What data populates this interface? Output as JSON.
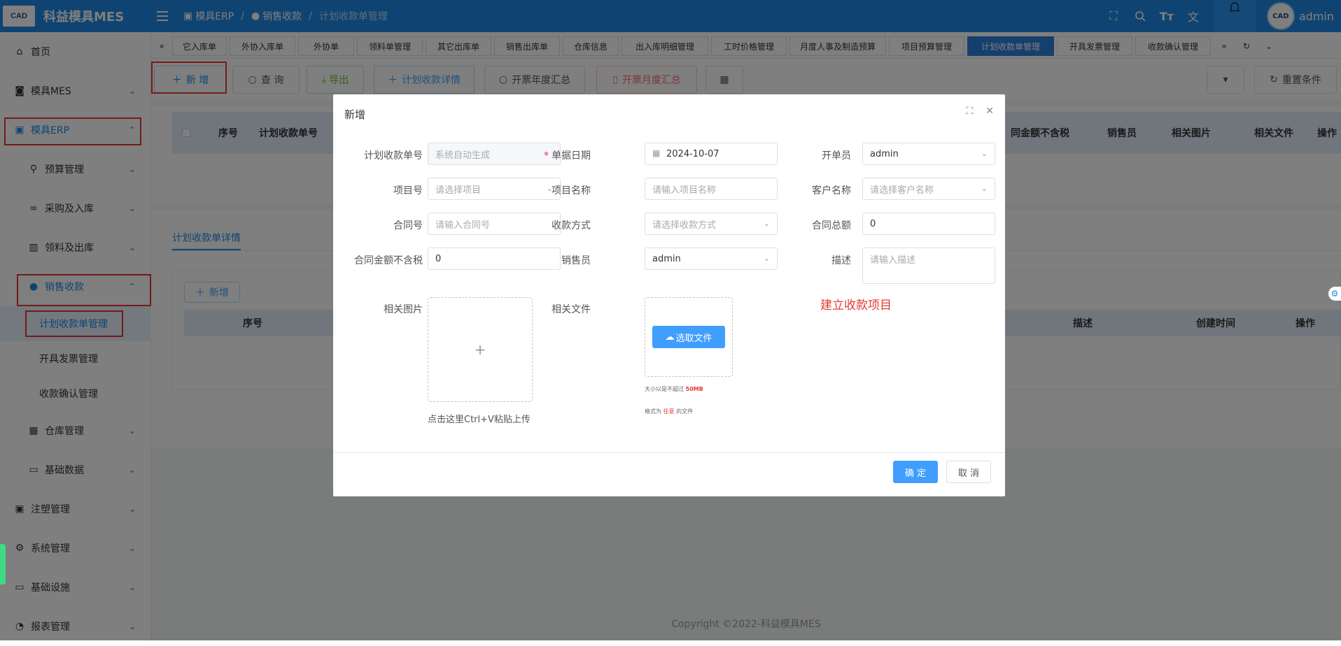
{
  "header": {
    "app_title": "科益模具MES",
    "logo_text": "CAD",
    "crumbs": [
      "模具ERP",
      "销售收款",
      "计划收款单管理"
    ],
    "user": "admin"
  },
  "sidebar": {
    "items": [
      {
        "label": "首页",
        "icon": "home-icon"
      },
      {
        "label": "模具MES",
        "icon": "camera-icon"
      },
      {
        "label": "模具ERP",
        "icon": "briefcase-icon"
      },
      {
        "label": "预算管理",
        "icon": "filter-icon"
      },
      {
        "label": "采购及入库",
        "icon": "bike-icon"
      },
      {
        "label": "领料及出库",
        "icon": "building-icon"
      },
      {
        "label": "销售收款",
        "icon": "user-icon"
      },
      {
        "label": "计划收款单管理"
      },
      {
        "label": "开具发票管理"
      },
      {
        "label": "收款确认管理"
      },
      {
        "label": "仓库管理",
        "icon": "calendar-icon"
      },
      {
        "label": "基础数据",
        "icon": "card-icon"
      },
      {
        "label": "注塑管理",
        "icon": "briefcase-icon"
      },
      {
        "label": "系统管理",
        "icon": "gear-icon"
      },
      {
        "label": "基础设施",
        "icon": "monitor-icon"
      },
      {
        "label": "报表管理",
        "icon": "pie-icon"
      }
    ]
  },
  "tabs": [
    "它入库单",
    "外协入库单",
    "外协单",
    "领料单管理",
    "其它出库单",
    "销售出库单",
    "仓库信息",
    "出入库明细管理",
    "工时价格管理",
    "月度人事及制造预算",
    "项目预算管理",
    "计划收款单管理",
    "开具发票管理",
    "收款确认管理"
  ],
  "toolbar": {
    "add": "新 增",
    "query": "查 询",
    "export": "导出",
    "plan_detail": "计划收款详情",
    "invoice_year": "开票年度汇总",
    "invoice_month": "开票月度汇总",
    "reset": "重置条件"
  },
  "table1": {
    "columns_left": [
      "序号",
      "计划收款单号"
    ],
    "columns_right": [
      "同金额不含税",
      "销售员",
      "相关图片",
      "相关文件",
      "操作"
    ]
  },
  "detail": {
    "tab": "计划收款单详情",
    "add": "新增",
    "columns_left": [
      "序号"
    ],
    "columns_right": [
      "描述",
      "创建时间",
      "操作"
    ]
  },
  "footer": "Copyright ©2022-科益模具MES",
  "dialog": {
    "title": "新增",
    "fields": {
      "plan_no": {
        "label": "计划收款单号",
        "placeholder": "系统自动生成"
      },
      "doc_date": {
        "label": "单据日期",
        "value": "2024-10-07"
      },
      "creator": {
        "label": "开单员",
        "value": "admin"
      },
      "project_no": {
        "label": "项目号",
        "placeholder": "请选择项目"
      },
      "project_name": {
        "label": "项目名称",
        "placeholder": "请输入项目名称"
      },
      "customer": {
        "label": "客户名称",
        "placeholder": "请选择客户名称"
      },
      "contract_no": {
        "label": "合同号",
        "placeholder": "请输入合同号"
      },
      "pay_method": {
        "label": "收款方式",
        "placeholder": "请选择收款方式"
      },
      "contract_total": {
        "label": "合同总额",
        "value": "0"
      },
      "amount_ex_tax": {
        "label": "合同金额不含税",
        "value": "0"
      },
      "salesman": {
        "label": "销售员",
        "value": "admin"
      },
      "description": {
        "label": "描述",
        "placeholder": "请输入描述"
      },
      "images": {
        "label": "相关图片",
        "paste_hint": "点击这里Ctrl+V粘贴上传"
      },
      "files": {
        "label": "相关文件",
        "button": "选取文件",
        "size_hint_pre": "大小以是不超过",
        "size_limit": "50MB",
        "format_hint_pre": "格式为",
        "format_value": "任意",
        "format_hint_post": "的文件"
      }
    },
    "annotation": "建立收款项目",
    "ok": "确 定",
    "cancel": "取 消"
  }
}
